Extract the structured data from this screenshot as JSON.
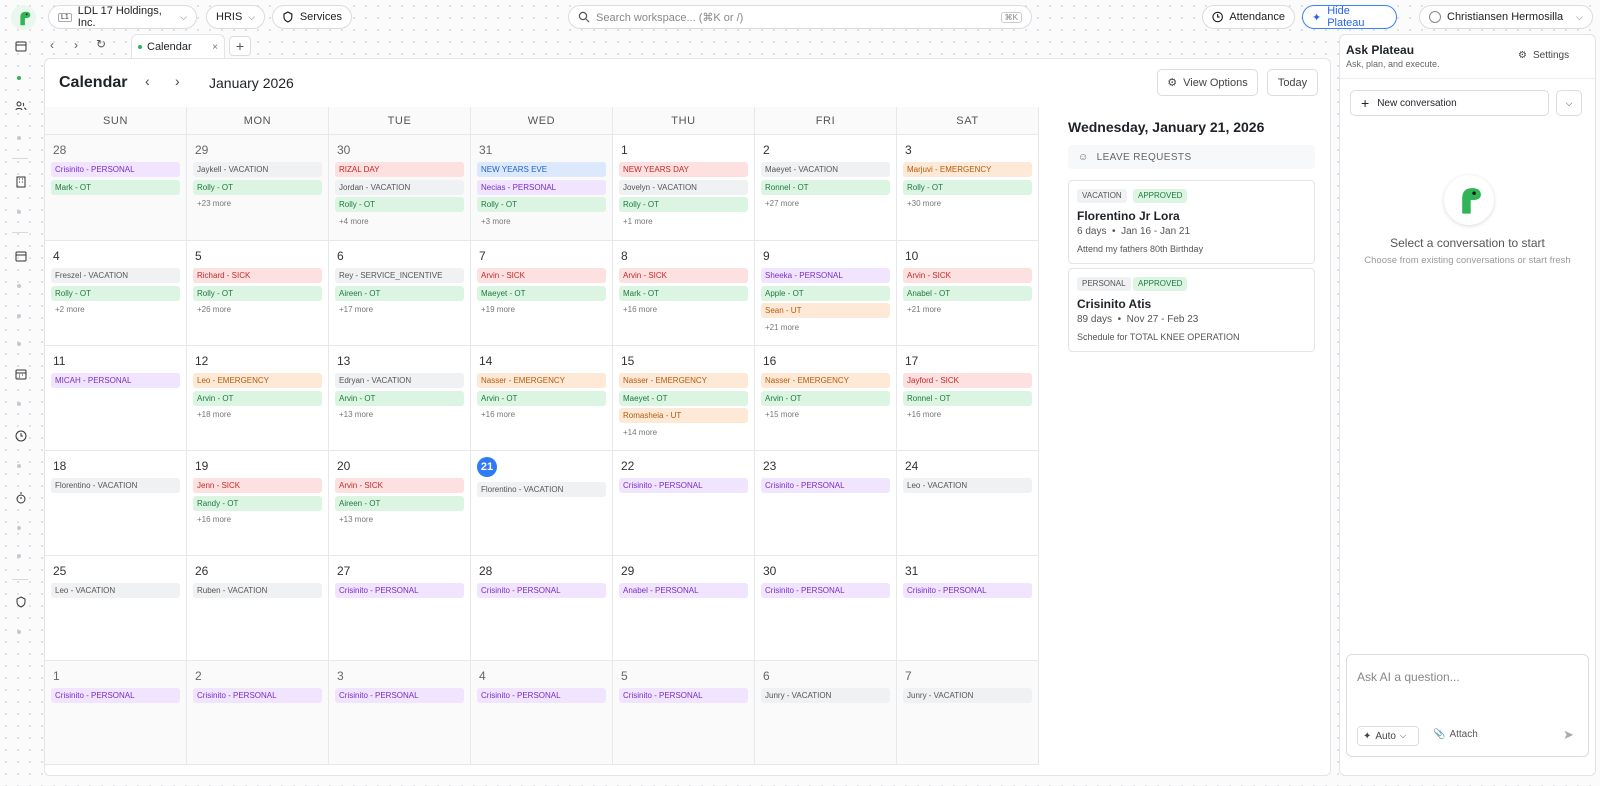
{
  "topbar": {
    "company": "LDL 17 Holdings, Inc.",
    "company_badge": "L1",
    "module": "HRIS",
    "services": "Services",
    "search_placeholder": "Search workspace... (⌘K or /)",
    "search_kbd": "⌘K",
    "attendance": "Attendance",
    "hide_plateau": "Hide Plateau",
    "user": "Christiansen Hermosilla"
  },
  "tab": {
    "label": "Calendar"
  },
  "calendar": {
    "title": "Calendar",
    "month": "January 2026",
    "view_options": "View Options",
    "today_button": "Today",
    "days_of_week": [
      "SUN",
      "MON",
      "TUE",
      "WED",
      "THU",
      "FRI",
      "SAT"
    ],
    "today_date": "21",
    "cells": [
      {
        "d": "28",
        "o": 1,
        "e": [
          [
            "Crisinito - PERSONAL",
            "purple"
          ],
          [
            "Mark - OT",
            "green"
          ]
        ]
      },
      {
        "d": "29",
        "o": 1,
        "e": [
          [
            "Jaykell - VACATION",
            "gray"
          ],
          [
            "Rolly - OT",
            "green"
          ]
        ],
        "m": "+23 more"
      },
      {
        "d": "30",
        "o": 1,
        "e": [
          [
            "RIZAL DAY",
            "red"
          ],
          [
            "Jordan - VACATION",
            "gray"
          ],
          [
            "Rolly - OT",
            "green"
          ]
        ],
        "m": "+4 more"
      },
      {
        "d": "31",
        "o": 1,
        "e": [
          [
            "NEW YEARS EVE",
            "blue"
          ],
          [
            "Necias - PERSONAL",
            "purple"
          ],
          [
            "Rolly - OT",
            "green"
          ]
        ],
        "m": "+3 more"
      },
      {
        "d": "1",
        "e": [
          [
            "NEW YEARS DAY",
            "red"
          ],
          [
            "Jovelyn - VACATION",
            "gray"
          ],
          [
            "Rolly - OT",
            "green"
          ]
        ],
        "m": "+1 more"
      },
      {
        "d": "2",
        "e": [
          [
            "Maeyet - VACATION",
            "gray"
          ],
          [
            "Ronnel - OT",
            "green"
          ]
        ],
        "m": "+27 more"
      },
      {
        "d": "3",
        "e": [
          [
            "Marjuvi - EMERGENCY",
            "orange"
          ],
          [
            "Rolly - OT",
            "green"
          ]
        ],
        "m": "+30 more"
      },
      {
        "d": "4",
        "e": [
          [
            "Freszel - VACATION",
            "gray"
          ],
          [
            "Rolly - OT",
            "green"
          ]
        ],
        "m": "+2 more"
      },
      {
        "d": "5",
        "e": [
          [
            "Richard - SICK",
            "red"
          ],
          [
            "Rolly - OT",
            "green"
          ]
        ],
        "m": "+26 more"
      },
      {
        "d": "6",
        "e": [
          [
            "Rey - SERVICE_INCENTIVE",
            "gray"
          ],
          [
            "Aireen - OT",
            "green"
          ]
        ],
        "m": "+17 more"
      },
      {
        "d": "7",
        "e": [
          [
            "Arvin - SICK",
            "red"
          ],
          [
            "Maeyet - OT",
            "green"
          ]
        ],
        "m": "+19 more"
      },
      {
        "d": "8",
        "e": [
          [
            "Arvin - SICK",
            "red"
          ],
          [
            "Mark - OT",
            "green"
          ]
        ],
        "m": "+16 more"
      },
      {
        "d": "9",
        "e": [
          [
            "Sheeka - PERSONAL",
            "purple"
          ],
          [
            "Apple - OT",
            "green"
          ],
          [
            "Sean - UT",
            "orange"
          ]
        ],
        "m": "+21 more"
      },
      {
        "d": "10",
        "e": [
          [
            "Arvin - SICK",
            "red"
          ],
          [
            "Anabel - OT",
            "green"
          ]
        ],
        "m": "+21 more"
      },
      {
        "d": "11",
        "e": [
          [
            "MICAH - PERSONAL",
            "purple"
          ]
        ]
      },
      {
        "d": "12",
        "e": [
          [
            "Leo - EMERGENCY",
            "orange"
          ],
          [
            "Arvin - OT",
            "green"
          ]
        ],
        "m": "+18 more"
      },
      {
        "d": "13",
        "e": [
          [
            "Edryan - VACATION",
            "gray"
          ],
          [
            "Arvin - OT",
            "green"
          ]
        ],
        "m": "+13 more"
      },
      {
        "d": "14",
        "e": [
          [
            "Nasser - EMERGENCY",
            "orange"
          ],
          [
            "Arvin - OT",
            "green"
          ]
        ],
        "m": "+16 more"
      },
      {
        "d": "15",
        "e": [
          [
            "Nasser - EMERGENCY",
            "orange"
          ],
          [
            "Maeyet - OT",
            "green"
          ],
          [
            "Romasheia - UT",
            "orange"
          ]
        ],
        "m": "+14 more"
      },
      {
        "d": "16",
        "e": [
          [
            "Nasser - EMERGENCY",
            "orange"
          ],
          [
            "Arvin - OT",
            "green"
          ]
        ],
        "m": "+15 more"
      },
      {
        "d": "17",
        "e": [
          [
            "Jayford - SICK",
            "red"
          ],
          [
            "Ronnel - OT",
            "green"
          ]
        ],
        "m": "+16 more"
      },
      {
        "d": "18",
        "e": [
          [
            "Florentino - VACATION",
            "gray"
          ]
        ]
      },
      {
        "d": "19",
        "e": [
          [
            "Jenn - SICK",
            "red"
          ],
          [
            "Randy - OT",
            "green"
          ]
        ],
        "m": "+16 more"
      },
      {
        "d": "20",
        "e": [
          [
            "Arvin - SICK",
            "red"
          ],
          [
            "Aireen - OT",
            "green"
          ]
        ],
        "m": "+13 more"
      },
      {
        "d": "21",
        "t": 1,
        "e": [
          [
            "Florentino - VACATION",
            "gray"
          ]
        ]
      },
      {
        "d": "22",
        "e": [
          [
            "Crisinito - PERSONAL",
            "purple"
          ]
        ]
      },
      {
        "d": "23",
        "e": [
          [
            "Crisinito - PERSONAL",
            "purple"
          ]
        ]
      },
      {
        "d": "24",
        "e": [
          [
            "Leo - VACATION",
            "gray"
          ]
        ]
      },
      {
        "d": "25",
        "e": [
          [
            "Leo - VACATION",
            "gray"
          ]
        ]
      },
      {
        "d": "26",
        "e": [
          [
            "Ruben - VACATION",
            "gray"
          ]
        ]
      },
      {
        "d": "27",
        "e": [
          [
            "Crisinito - PERSONAL",
            "purple"
          ]
        ]
      },
      {
        "d": "28",
        "e": [
          [
            "Crisinito - PERSONAL",
            "purple"
          ]
        ]
      },
      {
        "d": "29",
        "e": [
          [
            "Anabel - PERSONAL",
            "purple"
          ]
        ]
      },
      {
        "d": "30",
        "e": [
          [
            "Crisinito - PERSONAL",
            "purple"
          ]
        ]
      },
      {
        "d": "31",
        "e": [
          [
            "Crisinito - PERSONAL",
            "purple"
          ]
        ]
      },
      {
        "d": "1",
        "o": 1,
        "e": [
          [
            "Crisinito - PERSONAL",
            "purple"
          ]
        ]
      },
      {
        "d": "2",
        "o": 1,
        "e": [
          [
            "Crisinito - PERSONAL",
            "purple"
          ]
        ]
      },
      {
        "d": "3",
        "o": 1,
        "e": [
          [
            "Crisinito - PERSONAL",
            "purple"
          ]
        ]
      },
      {
        "d": "4",
        "o": 1,
        "e": [
          [
            "Crisinito - PERSONAL",
            "purple"
          ]
        ]
      },
      {
        "d": "5",
        "o": 1,
        "e": [
          [
            "Crisinito - PERSONAL",
            "purple"
          ]
        ]
      },
      {
        "d": "6",
        "o": 1,
        "e": [
          [
            "Junry - VACATION",
            "gray"
          ]
        ]
      },
      {
        "d": "7",
        "o": 1,
        "e": [
          [
            "Junry - VACATION",
            "gray"
          ]
        ]
      }
    ]
  },
  "detail": {
    "date_title": "Wednesday, January 21, 2026",
    "section": "LEAVE REQUESTS",
    "requests": [
      {
        "type": "VACATION",
        "status": "APPROVED",
        "name": "Florentino Jr Lora",
        "days": "6 days",
        "range": "Jan 16 - Jan 21",
        "reason": "Attend my fathers 80th Birthday"
      },
      {
        "type": "PERSONAL",
        "status": "APPROVED",
        "name": "Crisinito Atis",
        "days": "89 days",
        "range": "Nov 27 - Feb 23",
        "reason": "Schedule for TOTAL KNEE OPERATION"
      }
    ]
  },
  "assistant": {
    "title": "Ask Plateau",
    "subtitle": "Ask, plan, and execute.",
    "settings": "Settings",
    "new_conversation": "New conversation",
    "empty_title": "Select a conversation to start",
    "empty_subtitle": "Choose from existing conversations or start fresh",
    "input_placeholder": "Ask AI a question...",
    "mode": "Auto",
    "attach": "Attach"
  }
}
